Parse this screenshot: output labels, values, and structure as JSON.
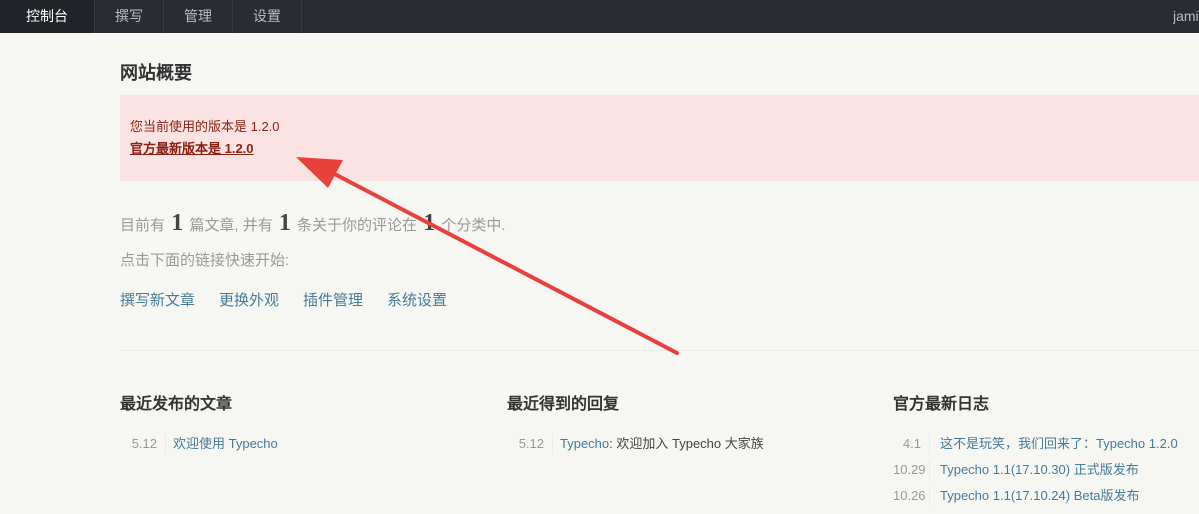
{
  "topbar": {
    "items": [
      {
        "label": "控制台"
      },
      {
        "label": "撰写"
      },
      {
        "label": "管理"
      },
      {
        "label": "设置"
      }
    ],
    "user": "jami"
  },
  "page": {
    "title": "网站概要"
  },
  "notice": {
    "current_version": "您当前使用的版本是 1.2.0",
    "latest_version_link": "官方最新版本是 1.2.0"
  },
  "stats": {
    "prefix": "目前有",
    "posts_count": "1",
    "mid1": "篇文章, 并有",
    "comments_count": "1",
    "mid2": "条关于你的评论在",
    "categories_count": "1",
    "suffix": "个分类中."
  },
  "hint": "点击下面的链接快速开始:",
  "quick_links": [
    {
      "label": "撰写新文章"
    },
    {
      "label": "更换外观"
    },
    {
      "label": "插件管理"
    },
    {
      "label": "系统设置"
    }
  ],
  "recent_posts": {
    "title": "最近发布的文章",
    "items": [
      {
        "date": "5.12",
        "text": "欢迎使用 Typecho"
      }
    ]
  },
  "recent_replies": {
    "title": "最近得到的回复",
    "items": [
      {
        "date": "5.12",
        "author": "Typecho",
        "text": ": 欢迎加入 Typecho 大家族"
      }
    ]
  },
  "official_news": {
    "title": "官方最新日志",
    "items": [
      {
        "date": "4.1",
        "text": "这不是玩笑，我们回来了：Typecho 1.2.0"
      },
      {
        "date": "10.29",
        "text": "Typecho 1.1(17.10.30) 正式版发布"
      },
      {
        "date": "10.26",
        "text": "Typecho 1.1(17.10.24) Beta版发布"
      }
    ]
  },
  "annotation": {
    "arrow_color": "#e8413c"
  }
}
